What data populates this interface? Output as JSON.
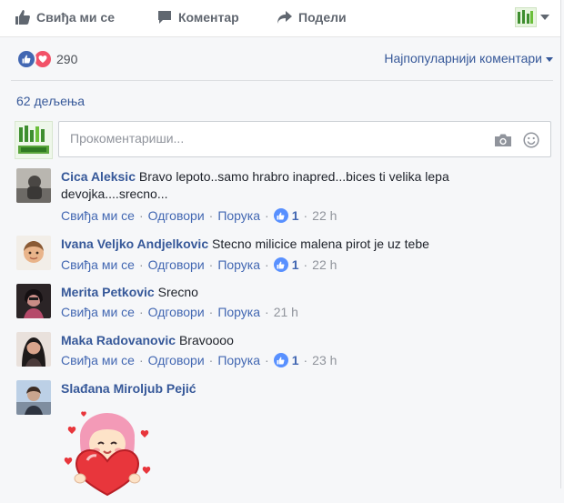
{
  "actions": {
    "like_label": "Свиђа ми се",
    "comment_label": "Коментар",
    "share_label": "Подели"
  },
  "reactions": {
    "count": "290",
    "sort_label": "Најпопуларнији коментари"
  },
  "shares": {
    "label": "62 дељења"
  },
  "composer": {
    "placeholder": "Прокоментариши..."
  },
  "comments": [
    {
      "author": "Cica Aleksic",
      "text": "Bravo lepoto..samo hrabro inapred...bices ti velika lepa devojka....srecno...",
      "like_label": "Свиђа ми се",
      "reply_label": "Одговори",
      "message_label": "Порука",
      "likes": "1",
      "time": "22 h"
    },
    {
      "author": "Ivana Veljko Andjelkovic",
      "text": "Stecno milicice malena pirot je uz tebe",
      "like_label": "Свиђа ми се",
      "reply_label": "Одговори",
      "message_label": "Порука",
      "likes": "1",
      "time": "22 h"
    },
    {
      "author": "Merita Petkovic",
      "text": "Srecno",
      "like_label": "Свиђа ми се",
      "reply_label": "Одговори",
      "message_label": "Порука",
      "time": "21 h"
    },
    {
      "author": "Maka Radovanovic",
      "text": "Bravoooo",
      "like_label": "Свиђа ми се",
      "reply_label": "Одговори",
      "message_label": "Порука",
      "likes": "1",
      "time": "23 h"
    },
    {
      "author": "Slađana Miroljub Pejić",
      "sticker": "girl-holding-heart-sticker"
    }
  ],
  "colors": {
    "link_blue": "#365899",
    "action_blue": "#4267b2",
    "meta_gray": "#90949c",
    "love_red": "#f25268"
  }
}
